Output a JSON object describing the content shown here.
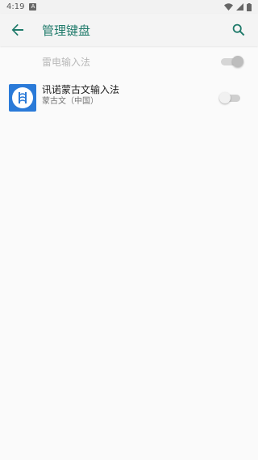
{
  "status": {
    "time": "4:19",
    "notif_icon": "A"
  },
  "toolbar": {
    "title": "管理键盘"
  },
  "keyboards": [
    {
      "name": "雷电输入法",
      "enabled": true,
      "disabled_row": true
    },
    {
      "name": "讯诺蒙古文输入法",
      "subtitle": "蒙古文（中国）",
      "enabled": false
    }
  ],
  "colors": {
    "accent": "#1f7a6a",
    "app_icon_bg": "#2a7ad8"
  }
}
